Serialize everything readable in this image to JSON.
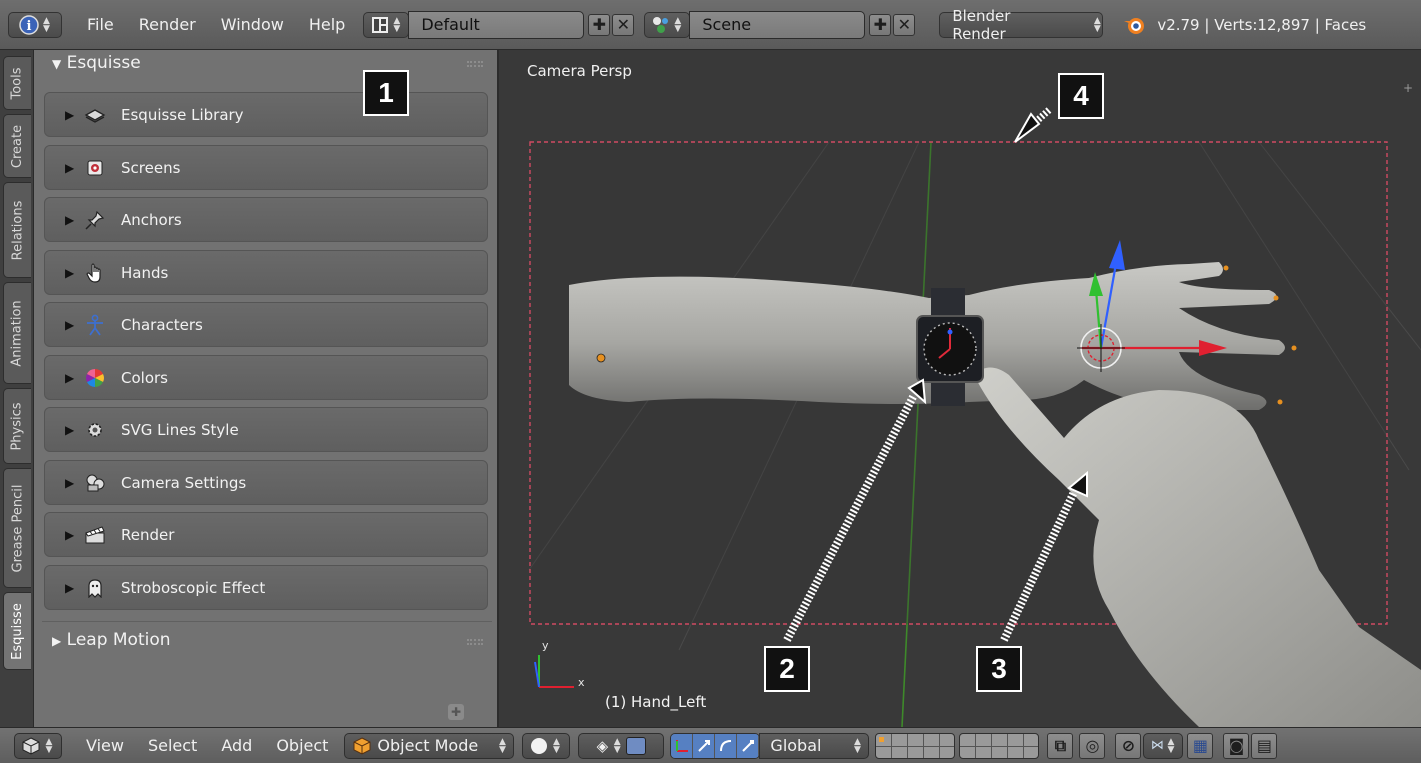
{
  "topbar": {
    "menus": [
      "File",
      "Render",
      "Window",
      "Help"
    ],
    "layout_field": "Default",
    "scene_field": "Scene",
    "engine": "Blender Render",
    "stats": "v2.79 | Verts:12,897 | Faces"
  },
  "side_tabs": [
    "Tools",
    "Create",
    "Relations",
    "Animation",
    "Physics",
    "Grease Pencil",
    "Esquisse"
  ],
  "panel": {
    "title": "Esquisse",
    "subpanels": [
      {
        "label": "Esquisse Library",
        "icon": "library-icon"
      },
      {
        "label": "Screens",
        "icon": "screens-icon"
      },
      {
        "label": "Anchors",
        "icon": "pin-icon"
      },
      {
        "label": "Hands",
        "icon": "hand-icon"
      },
      {
        "label": "Characters",
        "icon": "character-icon"
      },
      {
        "label": "Colors",
        "icon": "color-wheel-icon"
      },
      {
        "label": "SVG Lines Style",
        "icon": "gear-icon"
      },
      {
        "label": "Camera Settings",
        "icon": "camera-icon"
      },
      {
        "label": "Render",
        "icon": "clapperboard-icon"
      },
      {
        "label": "Stroboscopic Effect",
        "icon": "ghost-icon"
      }
    ],
    "second_title": "Leap Motion"
  },
  "viewport": {
    "view_label": "Camera Persp",
    "object_label": "(1) Hand_Left",
    "axis_labels": {
      "x": "x",
      "y": "y"
    }
  },
  "bottombar": {
    "menus": [
      "View",
      "Select",
      "Add",
      "Object"
    ],
    "mode": "Object Mode",
    "orientation": "Global"
  },
  "callouts": [
    "1",
    "2",
    "3",
    "4"
  ],
  "colors": {
    "accent_blue": "#5680c2",
    "dashed_frame": "#e0506a",
    "gizmo_red": "#e02030",
    "gizmo_green": "#30c030",
    "gizmo_blue": "#3060ff"
  }
}
